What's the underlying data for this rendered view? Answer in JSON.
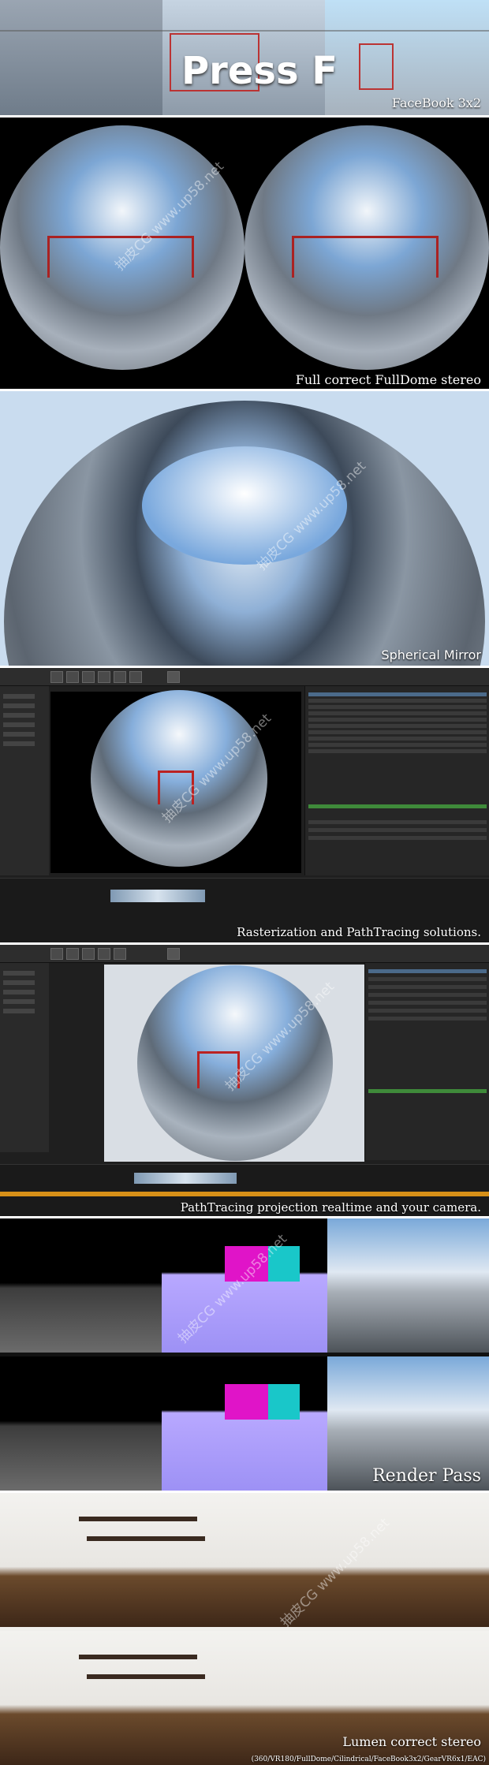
{
  "panels": {
    "p1": {
      "title_text": "Press F",
      "caption": "FaceBook 3x2"
    },
    "p2": {
      "caption": "Full correct FullDome stereo"
    },
    "p3": {
      "caption": "Spherical Mirror"
    },
    "p4": {
      "caption": "Rasterization and PathTracing solutions."
    },
    "p5": {
      "caption": "PathTracing projection realtime and your camera."
    },
    "p6": {
      "caption": "Render Pass"
    },
    "p7": {
      "caption": "Lumen correct stereo",
      "subcaption": "(360/VR180/FullDome/Cilindrical/FaceBook3x2/GearVR6x1/EAC)"
    }
  },
  "watermark": {
    "text": "抽皮CG www.up58.net"
  }
}
